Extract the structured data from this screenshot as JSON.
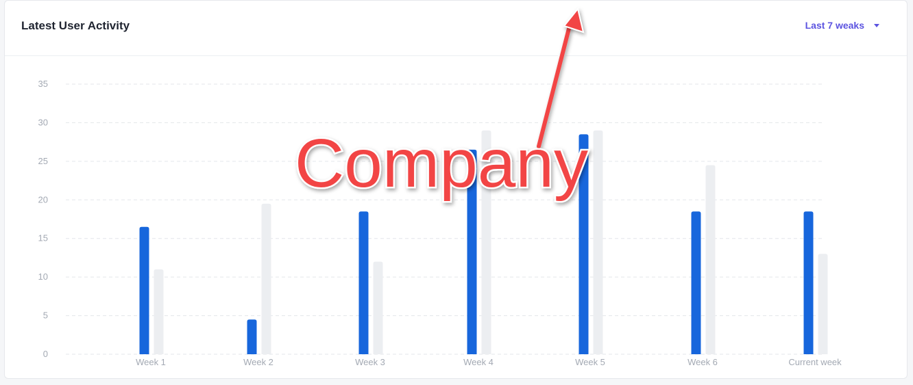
{
  "header": {
    "title": "Latest User Activity",
    "range_label": "Last 7 weaks"
  },
  "overlay": {
    "text": "Company"
  },
  "colors": {
    "primary_series": "#1766dc",
    "secondary_series": "#eceef1",
    "grid": "#e3e6ea",
    "accent": "#5b53e0",
    "annotation": "#f24545"
  },
  "chart_data": {
    "type": "bar",
    "title": "Latest User Activity",
    "categories": [
      "Week 1",
      "Week 2",
      "Week 3",
      "Week 4",
      "Week 5",
      "Week 6",
      "Current week"
    ],
    "series": [
      {
        "values": [
          16.5,
          4.5,
          18.5,
          26.5,
          28.5,
          18.5,
          18.5
        ]
      },
      {
        "values": [
          11,
          19.5,
          12,
          29,
          29,
          24.5,
          13
        ]
      }
    ],
    "ylim": [
      0,
      35
    ],
    "yticks": [
      0,
      5,
      10,
      15,
      20,
      25,
      30,
      35
    ],
    "grid": true,
    "legend": "none"
  }
}
